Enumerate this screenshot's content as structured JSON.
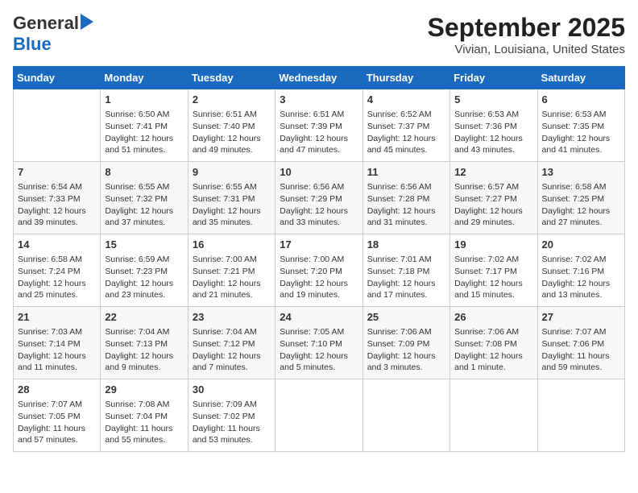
{
  "header": {
    "logo_line1": "General",
    "logo_line2": "Blue",
    "title": "September 2025",
    "subtitle": "Vivian, Louisiana, United States"
  },
  "days_of_week": [
    "Sunday",
    "Monday",
    "Tuesday",
    "Wednesday",
    "Thursday",
    "Friday",
    "Saturday"
  ],
  "weeks": [
    [
      {
        "day": "",
        "info": ""
      },
      {
        "day": "1",
        "info": "Sunrise: 6:50 AM\nSunset: 7:41 PM\nDaylight: 12 hours\nand 51 minutes."
      },
      {
        "day": "2",
        "info": "Sunrise: 6:51 AM\nSunset: 7:40 PM\nDaylight: 12 hours\nand 49 minutes."
      },
      {
        "day": "3",
        "info": "Sunrise: 6:51 AM\nSunset: 7:39 PM\nDaylight: 12 hours\nand 47 minutes."
      },
      {
        "day": "4",
        "info": "Sunrise: 6:52 AM\nSunset: 7:37 PM\nDaylight: 12 hours\nand 45 minutes."
      },
      {
        "day": "5",
        "info": "Sunrise: 6:53 AM\nSunset: 7:36 PM\nDaylight: 12 hours\nand 43 minutes."
      },
      {
        "day": "6",
        "info": "Sunrise: 6:53 AM\nSunset: 7:35 PM\nDaylight: 12 hours\nand 41 minutes."
      }
    ],
    [
      {
        "day": "7",
        "info": "Sunrise: 6:54 AM\nSunset: 7:33 PM\nDaylight: 12 hours\nand 39 minutes."
      },
      {
        "day": "8",
        "info": "Sunrise: 6:55 AM\nSunset: 7:32 PM\nDaylight: 12 hours\nand 37 minutes."
      },
      {
        "day": "9",
        "info": "Sunrise: 6:55 AM\nSunset: 7:31 PM\nDaylight: 12 hours\nand 35 minutes."
      },
      {
        "day": "10",
        "info": "Sunrise: 6:56 AM\nSunset: 7:29 PM\nDaylight: 12 hours\nand 33 minutes."
      },
      {
        "day": "11",
        "info": "Sunrise: 6:56 AM\nSunset: 7:28 PM\nDaylight: 12 hours\nand 31 minutes."
      },
      {
        "day": "12",
        "info": "Sunrise: 6:57 AM\nSunset: 7:27 PM\nDaylight: 12 hours\nand 29 minutes."
      },
      {
        "day": "13",
        "info": "Sunrise: 6:58 AM\nSunset: 7:25 PM\nDaylight: 12 hours\nand 27 minutes."
      }
    ],
    [
      {
        "day": "14",
        "info": "Sunrise: 6:58 AM\nSunset: 7:24 PM\nDaylight: 12 hours\nand 25 minutes."
      },
      {
        "day": "15",
        "info": "Sunrise: 6:59 AM\nSunset: 7:23 PM\nDaylight: 12 hours\nand 23 minutes."
      },
      {
        "day": "16",
        "info": "Sunrise: 7:00 AM\nSunset: 7:21 PM\nDaylight: 12 hours\nand 21 minutes."
      },
      {
        "day": "17",
        "info": "Sunrise: 7:00 AM\nSunset: 7:20 PM\nDaylight: 12 hours\nand 19 minutes."
      },
      {
        "day": "18",
        "info": "Sunrise: 7:01 AM\nSunset: 7:18 PM\nDaylight: 12 hours\nand 17 minutes."
      },
      {
        "day": "19",
        "info": "Sunrise: 7:02 AM\nSunset: 7:17 PM\nDaylight: 12 hours\nand 15 minutes."
      },
      {
        "day": "20",
        "info": "Sunrise: 7:02 AM\nSunset: 7:16 PM\nDaylight: 12 hours\nand 13 minutes."
      }
    ],
    [
      {
        "day": "21",
        "info": "Sunrise: 7:03 AM\nSunset: 7:14 PM\nDaylight: 12 hours\nand 11 minutes."
      },
      {
        "day": "22",
        "info": "Sunrise: 7:04 AM\nSunset: 7:13 PM\nDaylight: 12 hours\nand 9 minutes."
      },
      {
        "day": "23",
        "info": "Sunrise: 7:04 AM\nSunset: 7:12 PM\nDaylight: 12 hours\nand 7 minutes."
      },
      {
        "day": "24",
        "info": "Sunrise: 7:05 AM\nSunset: 7:10 PM\nDaylight: 12 hours\nand 5 minutes."
      },
      {
        "day": "25",
        "info": "Sunrise: 7:06 AM\nSunset: 7:09 PM\nDaylight: 12 hours\nand 3 minutes."
      },
      {
        "day": "26",
        "info": "Sunrise: 7:06 AM\nSunset: 7:08 PM\nDaylight: 12 hours\nand 1 minute."
      },
      {
        "day": "27",
        "info": "Sunrise: 7:07 AM\nSunset: 7:06 PM\nDaylight: 11 hours\nand 59 minutes."
      }
    ],
    [
      {
        "day": "28",
        "info": "Sunrise: 7:07 AM\nSunset: 7:05 PM\nDaylight: 11 hours\nand 57 minutes."
      },
      {
        "day": "29",
        "info": "Sunrise: 7:08 AM\nSunset: 7:04 PM\nDaylight: 11 hours\nand 55 minutes."
      },
      {
        "day": "30",
        "info": "Sunrise: 7:09 AM\nSunset: 7:02 PM\nDaylight: 11 hours\nand 53 minutes."
      },
      {
        "day": "",
        "info": ""
      },
      {
        "day": "",
        "info": ""
      },
      {
        "day": "",
        "info": ""
      },
      {
        "day": "",
        "info": ""
      }
    ]
  ]
}
